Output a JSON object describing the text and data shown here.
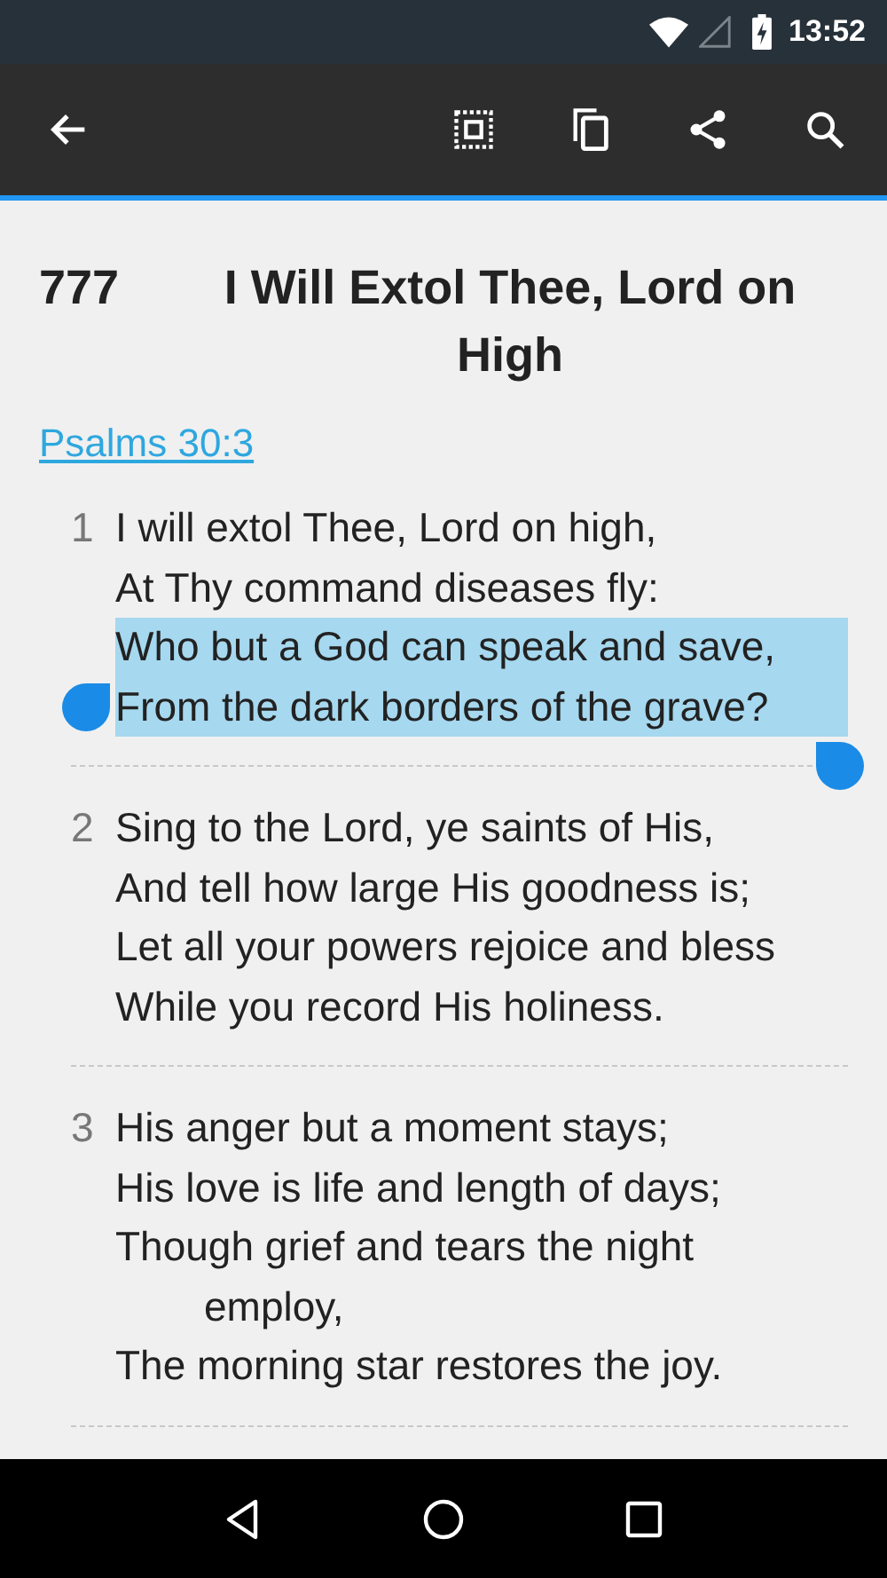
{
  "status_bar": {
    "time": "13:52"
  },
  "hymn": {
    "number": "777",
    "title": "I Will Extol Thee, Lord on High",
    "reference": "Psalms 30:3"
  },
  "verses": [
    {
      "number": "1",
      "lines": [
        {
          "text": "I will extol Thee, Lord on high,",
          "selected": false
        },
        {
          "text": "At Thy command diseases fly:",
          "selected": false
        },
        {
          "text": "Who but a God can speak and save,",
          "selected": true
        },
        {
          "text": "From the dark borders of the grave?",
          "selected": true
        }
      ]
    },
    {
      "number": "2",
      "lines": [
        {
          "text": "Sing to the Lord, ye saints of His,",
          "selected": false
        },
        {
          "text": "And tell how large His goodness is;",
          "selected": false
        },
        {
          "text": "Let all your powers rejoice and bless",
          "selected": false
        },
        {
          "text": "While you record His holiness.",
          "selected": false
        }
      ]
    },
    {
      "number": "3",
      "lines": [
        {
          "text": "His anger but a moment stays;",
          "selected": false
        },
        {
          "text": "His love is life and length of days;",
          "selected": false
        },
        {
          "text": "Though grief and tears the night employ,",
          "selected": false
        },
        {
          "text": "The morning star restores the joy.",
          "selected": false
        }
      ]
    }
  ]
}
